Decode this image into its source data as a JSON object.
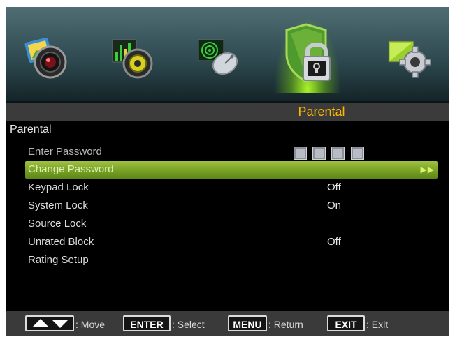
{
  "header": {
    "tabs": [
      {
        "name": "picture",
        "icon": "picture-camera-icon"
      },
      {
        "name": "sound",
        "icon": "sound-speaker-icon"
      },
      {
        "name": "channel",
        "icon": "channel-satellite-icon"
      },
      {
        "name": "parental",
        "icon": "parental-lock-icon",
        "active": true
      },
      {
        "name": "setup",
        "icon": "setup-gear-icon"
      }
    ],
    "category_title": "Parental"
  },
  "menu": {
    "title": "Parental",
    "items": [
      {
        "label": "Enter Password",
        "password_boxes": 4
      },
      {
        "label": "Change Password",
        "selected": true
      },
      {
        "label": "Keypad Lock",
        "value": "Off"
      },
      {
        "label": "System Lock",
        "value": "On"
      },
      {
        "label": "Source Lock"
      },
      {
        "label": "Unrated Block",
        "value": "Off"
      },
      {
        "label": "Rating Setup"
      }
    ]
  },
  "footer": {
    "move_label": ": Move",
    "enter_key": "ENTER",
    "select_label": ": Select",
    "menu_key": "MENU",
    "return_label": ": Return",
    "exit_key": "EXIT",
    "exit_label": ": Exit"
  },
  "colors": {
    "accent_title": "#ffb800",
    "selection_green": "#8ab431",
    "active_glow": "#afff28"
  }
}
